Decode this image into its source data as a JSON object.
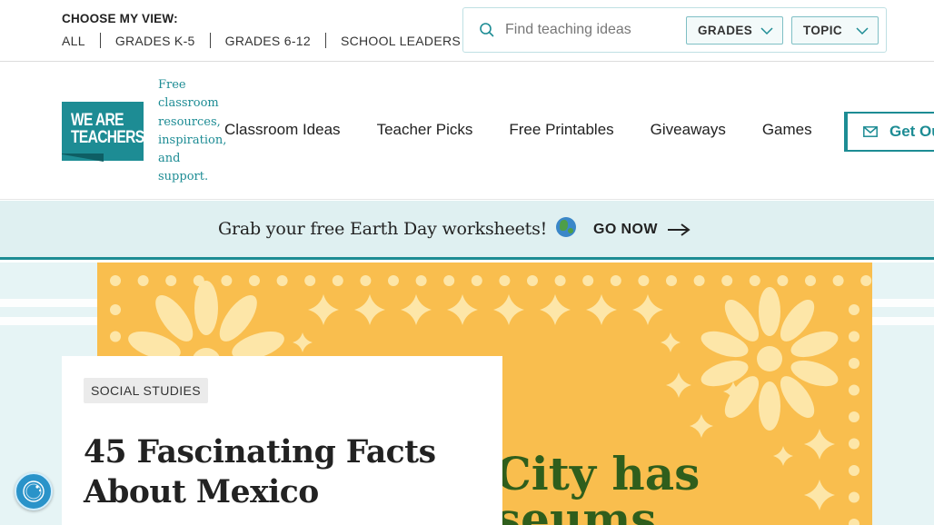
{
  "topbar": {
    "view_label": "CHOOSE MY VIEW:",
    "views": [
      "ALL",
      "GRADES K-5",
      "GRADES 6-12",
      "SCHOOL LEADERS"
    ],
    "search": {
      "placeholder": "Find teaching ideas",
      "icon": "search-icon"
    },
    "filters": {
      "grades": "GRADES",
      "topic": "TOPIC"
    }
  },
  "header": {
    "logo_text": "WE ARE TEACHERS",
    "tagline": "Free classroom resources, inspiration, and support.",
    "nav": [
      "Classroom Ideas",
      "Teacher Picks",
      "Free Printables",
      "Giveaways",
      "Games"
    ],
    "cta": "Get Ou"
  },
  "promo": {
    "text": "Grab your free Earth Day worksheets!",
    "link": "GO NOW"
  },
  "article": {
    "category": "SOCIAL STUDIES",
    "title": "45 Fascinating Facts About Mexico",
    "hero_text_line1": "City has",
    "hero_text_line2": "seums."
  },
  "colors": {
    "brand_teal": "#1d8c94",
    "promo_bg": "#dff0f1",
    "hero_yellow": "#f9be4e",
    "hero_pattern": "#fde6a8",
    "hero_text_green": "#2f5e1c"
  }
}
